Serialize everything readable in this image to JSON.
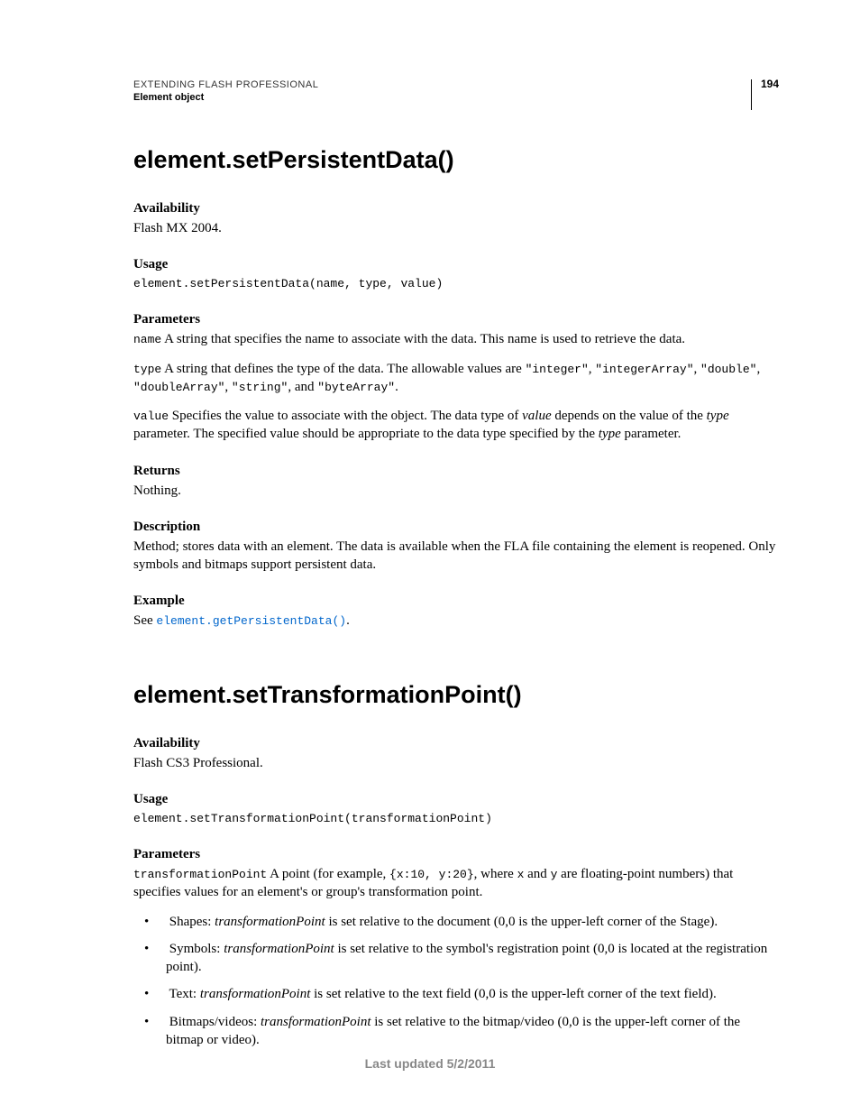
{
  "header": {
    "line1": "EXTENDING FLASH PROFESSIONAL",
    "line2": "Element object",
    "pageNumber": "194"
  },
  "method1": {
    "title": "element.setPersistentData()",
    "availability": {
      "label": "Availability",
      "text": "Flash MX 2004."
    },
    "usage": {
      "label": "Usage",
      "code": "element.setPersistentData(name, type, value)"
    },
    "parameters": {
      "label": "Parameters",
      "name_code": "name",
      "name_text": "  A string that specifies the name to associate with the data. This name is used to retrieve the data.",
      "type_code": "type",
      "type_text_a": "  A string that defines the type of the data. The allowable values are ",
      "type_vals": {
        "v1": "\"integer\"",
        "v2": "\"integerArray\"",
        "v3": "\"double\"",
        "v4": "\"doubleArray\"",
        "v5": "\"string\"",
        "v6": "\"byteArray\""
      },
      "sep": ", ",
      "and": ", and ",
      "period": ".",
      "value_code": "value",
      "value_text_a": "  Specifies the value to associate with the object. The data type of ",
      "value_ital1": "value",
      "value_text_b": " depends on the value of the ",
      "value_ital2": "type",
      "value_text_c": " parameter. The specified value should be appropriate to the data type specified by the ",
      "value_ital3": "type",
      "value_text_d": " parameter."
    },
    "returns": {
      "label": "Returns",
      "text": "Nothing."
    },
    "description": {
      "label": "Description",
      "text": "Method; stores data with an element. The data is available when the FLA file containing the element is reopened. Only symbols and bitmaps support persistent data."
    },
    "example": {
      "label": "Example",
      "pre": "See ",
      "link": "element.getPersistentData()",
      "post": "."
    }
  },
  "method2": {
    "title": "element.setTransformationPoint()",
    "availability": {
      "label": "Availability",
      "text": "Flash CS3 Professional."
    },
    "usage": {
      "label": "Usage",
      "code": "element.setTransformationPoint(transformationPoint)"
    },
    "parameters": {
      "label": "Parameters",
      "tp_code": "transformationPoint",
      "tp_text_a": "  A point (for example, ",
      "tp_example": "{x:10, y:20}",
      "tp_text_b": ", where ",
      "tp_x": "x",
      "tp_text_c": " and ",
      "tp_y": "y",
      "tp_text_d": " are floating-point numbers) that specifies values for an element's or group's transformation point."
    },
    "bullets": {
      "b1": {
        "lead": "Shapes: ",
        "ital": "transformationPoint",
        "rest": " is set relative to the document (0,0 is the upper-left corner of the Stage)."
      },
      "b2": {
        "lead": "Symbols: ",
        "ital": "transformationPoint",
        "rest": " is set relative to the symbol's registration point (0,0 is located at the registration point)."
      },
      "b3": {
        "lead": "Text: ",
        "ital": "transformationPoint",
        "rest": " is set relative to the text field (0,0 is the upper-left corner of the text field)."
      },
      "b4": {
        "lead": "Bitmaps/videos: ",
        "ital": "transformationPoint",
        "rest": " is set relative to the bitmap/video (0,0 is the upper-left corner of the bitmap or video)."
      }
    }
  },
  "footer": "Last updated 5/2/2011"
}
